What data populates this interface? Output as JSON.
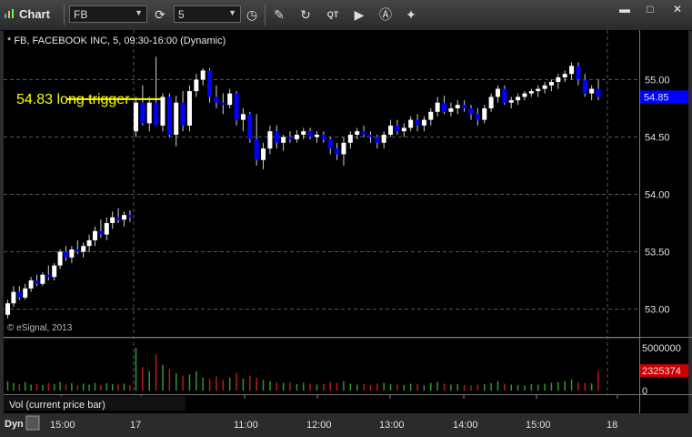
{
  "toolbar": {
    "title": "Chart",
    "symbol": "FB",
    "interval": "5",
    "buttons": [
      "refresh-icon",
      "clock-icon",
      "pencil-icon",
      "cursor-icon",
      "quote-icon",
      "play-icon",
      "a-icon",
      "tools-icon"
    ]
  },
  "chart_data": {
    "type": "candlestick",
    "title": "* FB, FACEBOOK INC, 5, 09:30-16:00 (Dynamic)",
    "watermark": "© eSignal, 2013",
    "annotation": "54.83 long trigger",
    "annotation_price": 54.83,
    "price_ticks": [
      "53.00",
      "53.50",
      "54.00",
      "54.50",
      "55.00"
    ],
    "current_price": "54.85",
    "volume_label": "Vol (current price bar)",
    "volume_ticks": [
      "5000000",
      "0"
    ],
    "current_volume": "2325374",
    "volume_max": 5000000,
    "x_ticks": [
      "15:00",
      "17",
      "11:00",
      "12:00",
      "13:00",
      "14:00",
      "15:00",
      "18"
    ],
    "bottom_label": "Dyn",
    "colors": {
      "up": "#ffffff",
      "down": "#0000ff",
      "vol_up": "#2e9a2e",
      "vol_down": "#b81b1b",
      "price_flag": "#0000ff",
      "volume_flag": "#cc0000",
      "annotation": "#ffff00"
    },
    "day1_candles": [
      [
        52.95,
        53.08,
        52.92,
        53.05
      ],
      [
        53.05,
        53.2,
        53.02,
        53.15
      ],
      [
        53.15,
        53.2,
        53.08,
        53.1
      ],
      [
        53.1,
        53.22,
        53.08,
        53.18
      ],
      [
        53.18,
        53.28,
        53.15,
        53.25
      ],
      [
        53.25,
        53.3,
        53.2,
        53.22
      ],
      [
        53.22,
        53.32,
        53.2,
        53.3
      ],
      [
        53.3,
        53.38,
        53.25,
        53.28
      ],
      [
        53.28,
        53.4,
        53.25,
        53.38
      ],
      [
        53.38,
        53.52,
        53.35,
        53.5
      ],
      [
        53.5,
        53.55,
        53.42,
        53.45
      ],
      [
        53.45,
        53.55,
        53.4,
        53.52
      ],
      [
        53.52,
        53.6,
        53.48,
        53.5
      ],
      [
        53.5,
        53.58,
        53.45,
        53.55
      ],
      [
        53.55,
        53.65,
        53.5,
        53.6
      ],
      [
        53.6,
        53.72,
        53.55,
        53.68
      ],
      [
        53.68,
        53.78,
        53.62,
        53.65
      ],
      [
        53.65,
        53.8,
        53.6,
        53.75
      ],
      [
        53.75,
        53.85,
        53.7,
        53.8
      ],
      [
        53.8,
        53.88,
        53.75,
        53.78
      ],
      [
        53.78,
        53.85,
        53.72,
        53.82
      ],
      [
        53.82,
        53.86,
        53.76,
        53.8
      ]
    ],
    "day2_candles": [
      [
        54.55,
        54.85,
        54.5,
        54.8
      ],
      [
        54.8,
        54.95,
        54.6,
        54.62
      ],
      [
        54.62,
        54.85,
        54.55,
        54.8
      ],
      [
        54.8,
        55.2,
        54.7,
        54.6
      ],
      [
        54.6,
        54.88,
        54.55,
        54.85
      ],
      [
        54.85,
        54.88,
        54.5,
        54.52
      ],
      [
        54.52,
        54.86,
        54.42,
        54.8
      ],
      [
        54.8,
        54.9,
        54.55,
        54.6
      ],
      [
        54.6,
        54.95,
        54.55,
        54.9
      ],
      [
        54.9,
        55.05,
        54.85,
        55.0
      ],
      [
        55.0,
        55.1,
        54.95,
        55.08
      ],
      [
        55.08,
        55.1,
        54.8,
        54.85
      ],
      [
        54.85,
        54.95,
        54.75,
        54.8
      ],
      [
        54.8,
        54.88,
        54.7,
        54.78
      ],
      [
        54.78,
        54.92,
        54.75,
        54.88
      ],
      [
        54.88,
        54.9,
        54.6,
        54.65
      ],
      [
        54.65,
        54.75,
        54.55,
        54.7
      ],
      [
        54.7,
        54.72,
        54.45,
        54.48
      ],
      [
        54.48,
        54.7,
        54.25,
        54.3
      ],
      [
        54.3,
        54.45,
        54.22,
        54.4
      ],
      [
        54.4,
        54.6,
        54.35,
        54.55
      ],
      [
        54.55,
        54.6,
        54.4,
        54.45
      ],
      [
        54.45,
        54.52,
        54.38,
        54.5
      ],
      [
        54.5,
        54.55,
        54.45,
        54.48
      ],
      [
        54.48,
        54.56,
        54.45,
        54.52
      ],
      [
        54.52,
        54.58,
        54.48,
        54.55
      ],
      [
        54.55,
        54.58,
        54.48,
        54.5
      ],
      [
        54.5,
        54.55,
        54.45,
        54.52
      ],
      [
        54.52,
        54.55,
        54.45,
        54.48
      ],
      [
        54.48,
        54.5,
        54.35,
        54.4
      ],
      [
        54.4,
        54.45,
        54.3,
        54.35
      ],
      [
        54.35,
        54.5,
        54.25,
        54.45
      ],
      [
        54.45,
        54.55,
        54.4,
        54.52
      ],
      [
        54.52,
        54.58,
        54.48,
        54.55
      ],
      [
        54.55,
        54.6,
        54.5,
        54.52
      ],
      [
        54.52,
        54.55,
        54.45,
        54.5
      ],
      [
        54.5,
        54.52,
        54.4,
        54.45
      ],
      [
        54.45,
        54.55,
        54.4,
        54.52
      ],
      [
        54.52,
        54.65,
        54.5,
        54.6
      ],
      [
        54.6,
        54.65,
        54.52,
        54.55
      ],
      [
        54.55,
        54.62,
        54.5,
        54.58
      ],
      [
        54.58,
        54.68,
        54.55,
        54.65
      ],
      [
        54.65,
        54.7,
        54.55,
        54.6
      ],
      [
        54.6,
        54.68,
        54.55,
        54.65
      ],
      [
        54.65,
        54.75,
        54.6,
        54.72
      ],
      [
        54.72,
        54.85,
        54.68,
        54.8
      ],
      [
        54.8,
        54.86,
        54.7,
        54.72
      ],
      [
        54.72,
        54.8,
        54.68,
        54.75
      ],
      [
        54.75,
        54.82,
        54.7,
        54.78
      ],
      [
        54.78,
        54.82,
        54.72,
        54.75
      ],
      [
        54.75,
        54.78,
        54.65,
        54.7
      ],
      [
        54.7,
        54.75,
        54.6,
        54.65
      ],
      [
        54.65,
        54.78,
        54.62,
        54.75
      ],
      [
        54.75,
        54.88,
        54.72,
        54.85
      ],
      [
        54.85,
        54.95,
        54.8,
        54.92
      ],
      [
        54.92,
        54.95,
        54.78,
        54.8
      ],
      [
        54.8,
        54.85,
        54.75,
        54.82
      ],
      [
        54.82,
        54.88,
        54.78,
        54.85
      ],
      [
        54.85,
        54.9,
        54.82,
        54.88
      ],
      [
        54.88,
        54.92,
        54.85,
        54.9
      ],
      [
        54.9,
        54.95,
        54.85,
        54.92
      ],
      [
        54.92,
        54.98,
        54.88,
        54.95
      ],
      [
        54.95,
        55.0,
        54.9,
        54.98
      ],
      [
        54.98,
        55.05,
        54.92,
        55.02
      ],
      [
        55.02,
        55.08,
        54.98,
        55.05
      ],
      [
        55.05,
        55.15,
        55.0,
        55.12
      ],
      [
        55.12,
        55.15,
        54.95,
        55.0
      ],
      [
        55.0,
        55.05,
        54.85,
        54.88
      ],
      [
        54.88,
        54.95,
        54.82,
        54.92
      ],
      [
        54.92,
        55.0,
        54.82,
        54.85
      ]
    ],
    "volumes_day1": [
      0.22,
      0.18,
      0.15,
      0.2,
      0.14,
      0.16,
      0.13,
      0.18,
      0.15,
      0.2,
      0.14,
      0.17,
      0.12,
      0.16,
      0.14,
      0.18,
      0.13,
      0.17,
      0.15,
      0.14,
      0.16,
      0.12
    ],
    "volumes_day2": [
      1.0,
      0.55,
      0.45,
      0.85,
      0.6,
      0.5,
      0.4,
      0.35,
      0.38,
      0.45,
      0.3,
      0.28,
      0.33,
      0.25,
      0.3,
      0.42,
      0.28,
      0.35,
      0.3,
      0.25,
      0.22,
      0.2,
      0.18,
      0.2,
      0.15,
      0.18,
      0.16,
      0.14,
      0.15,
      0.2,
      0.18,
      0.22,
      0.16,
      0.14,
      0.15,
      0.13,
      0.16,
      0.18,
      0.15,
      0.14,
      0.13,
      0.16,
      0.15,
      0.12,
      0.18,
      0.2,
      0.16,
      0.14,
      0.15,
      0.13,
      0.12,
      0.14,
      0.15,
      0.17,
      0.22,
      0.16,
      0.14,
      0.13,
      0.12,
      0.15,
      0.14,
      0.16,
      0.18,
      0.2,
      0.22,
      0.26,
      0.2,
      0.18,
      0.17,
      0.46
    ]
  }
}
